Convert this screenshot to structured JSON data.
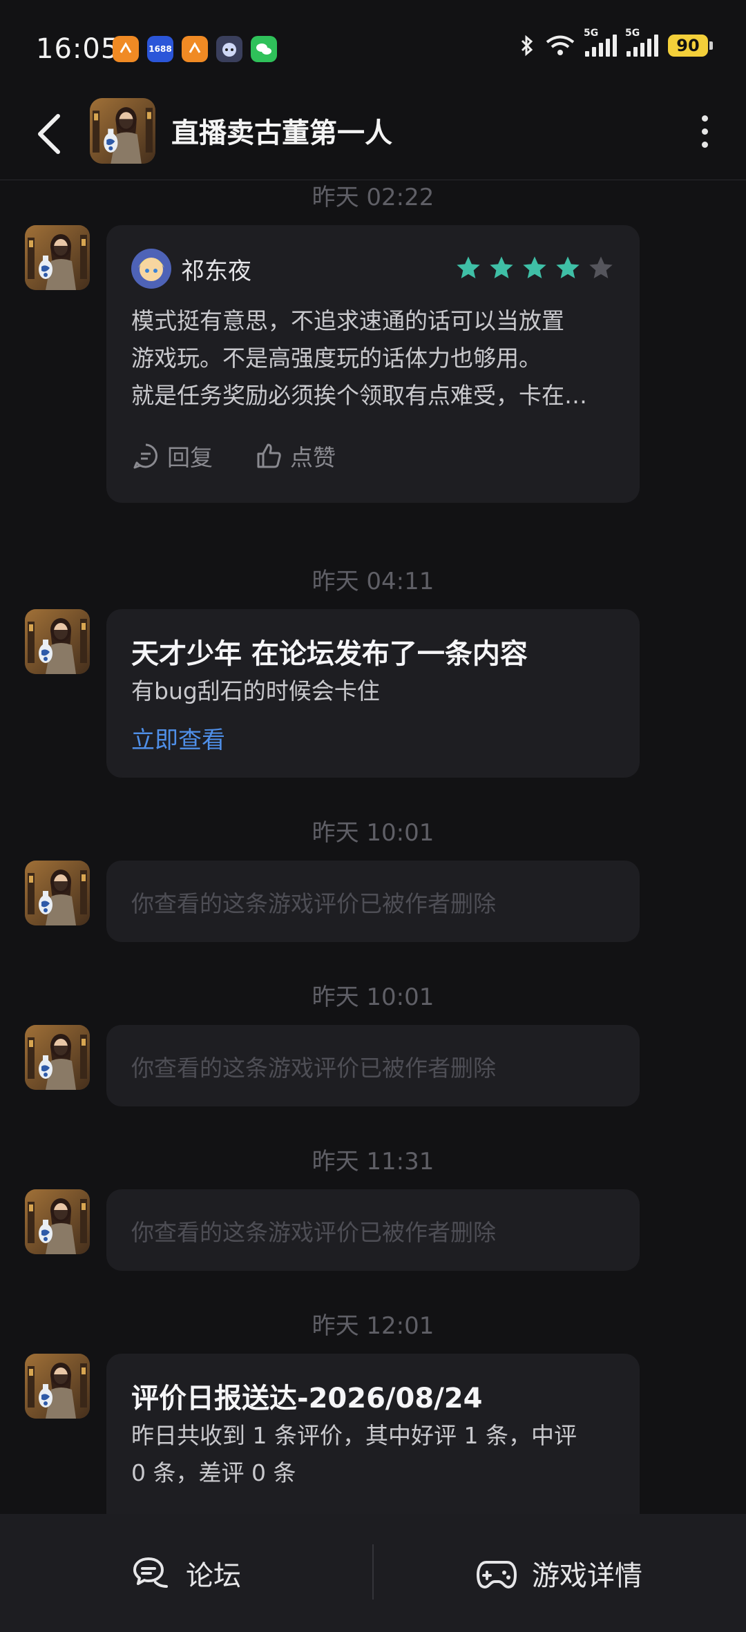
{
  "status_bar": {
    "time": "16:05",
    "notification_icons": [
      "taobao-icon",
      "1688-icon",
      "taobao-icon",
      "bot-app-icon",
      "wechat-icon"
    ],
    "app_1688_label": "1688",
    "signal_tag_1": "5G",
    "signal_tag_2": "5G",
    "battery": "90",
    "colors": {
      "battery": "#f3cf3a"
    }
  },
  "header": {
    "title": "直播卖古董第一人",
    "back_icon": "chevron-left-icon",
    "more_icon": "more-vertical-icon"
  },
  "messages": [
    {
      "time": "昨天  02:22",
      "type": "review",
      "user": "祁东夜",
      "rating": 4,
      "rating_max": 5,
      "text_lines": [
        "模式挺有意思，不追求速通的话可以当放置",
        "游戏玩。不是高强度玩的话体力也够用。",
        "就是任务奖励必须挨个领取有点难受，卡在…"
      ],
      "reply_label": "回复",
      "like_label": "点赞"
    },
    {
      "time": "昨天  04:11",
      "type": "forum",
      "title": "天才少年 在论坛发布了一条内容",
      "body": "有bug刮石的时候会卡住",
      "link": "立即查看"
    },
    {
      "time": "昨天  10:01",
      "type": "deleted",
      "text": "你查看的这条游戏评价已被作者删除"
    },
    {
      "time": "昨天  10:01",
      "type": "deleted",
      "text": "你查看的这条游戏评价已被作者删除"
    },
    {
      "time": "昨天  11:31",
      "type": "deleted",
      "text": "你查看的这条游戏评价已被作者删除"
    },
    {
      "time": "昨天  12:01",
      "type": "report",
      "title": "评价日报送达-2026/08/24",
      "body_lines": [
        "昨日共收到 1 条评价，其中好评 1 条，中评",
        "0 条，差评 0 条"
      ]
    }
  ],
  "bottom_bar": {
    "forum_label": "论坛",
    "forum_icon": "chat-bubble-icon",
    "details_label": "游戏详情",
    "details_icon": "gamepad-icon"
  },
  "colors": {
    "background": "#121214",
    "card": "#1e1e22",
    "star_filled": "#3fbfa6",
    "star_empty": "#55555c",
    "link": "#4f8fe8"
  }
}
